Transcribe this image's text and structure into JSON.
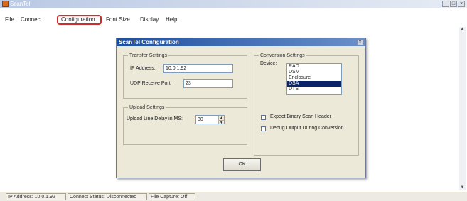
{
  "window": {
    "title": "ScanTel",
    "min": "_",
    "max": "□",
    "close": "×"
  },
  "menu": [
    "File",
    "Connect",
    "Configuration",
    "Font Size",
    "Display",
    "Help"
  ],
  "dialog": {
    "title": "ScanTel Configuration",
    "close": "x",
    "transfer": {
      "label": "Transfer Settings",
      "ip_label": "IP Address:",
      "ip_value": "10.0.1.92",
      "udp_label": "UDP Receive Port:",
      "udp_value": "23"
    },
    "upload": {
      "label": "Upload Settings",
      "delay_label": "Upload Line Delay in MS:",
      "delay_value": "30",
      "spin_up": "▲",
      "spin_down": "▼"
    },
    "conversion": {
      "label": "Conversion Settings",
      "device_label": "Device:",
      "devices": [
        "RAD",
        "DSM",
        "Enclosure",
        "DSA",
        "DTS"
      ],
      "selected_index": 3,
      "binary_label": "Expect Binary Scan Header",
      "binary_checked": false,
      "debug_label": "Debug Output During Conversion",
      "debug_checked": false
    },
    "ok": "OK"
  },
  "status": {
    "ip": "IP Address: 10.0.1.92",
    "connect": "Connect Status: Disconnected",
    "capture": "File Capture: Off"
  },
  "scroll": {
    "up": "▲",
    "down": "▼"
  }
}
